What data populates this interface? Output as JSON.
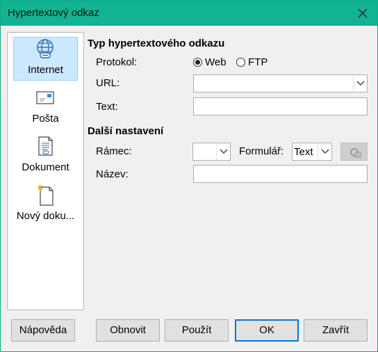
{
  "window": {
    "title": "Hypertextový odkaz",
    "close_icon": "close-icon"
  },
  "sidebar": {
    "items": [
      {
        "label": "Internet",
        "icon": "globe-link-icon",
        "selected": true
      },
      {
        "label": "Pošta",
        "icon": "envelope-icon",
        "selected": false
      },
      {
        "label": "Dokument",
        "icon": "document-icon",
        "selected": false
      },
      {
        "label": "Nový doku...",
        "icon": "new-document-icon",
        "selected": false
      }
    ]
  },
  "type_section": {
    "heading": "Typ hypertextového odkazu",
    "protocol_label": "Protokol:",
    "protocols": [
      {
        "label": "Web",
        "checked": true
      },
      {
        "label": "FTP",
        "checked": false
      }
    ],
    "url_label": "URL:",
    "url_value": "",
    "text_label": "Text:",
    "text_value": ""
  },
  "more_section": {
    "heading": "Další nastavení",
    "frame_label": "Rámec:",
    "frame_value": "",
    "form_label": "Formulář:",
    "form_value": "Text",
    "events_icon": "events-macro-icon",
    "name_label": "Název:",
    "name_value": ""
  },
  "buttons": {
    "help": "Nápověda",
    "reset": "Obnovit",
    "apply": "Použít",
    "ok": "OK",
    "close": "Zavřít"
  }
}
